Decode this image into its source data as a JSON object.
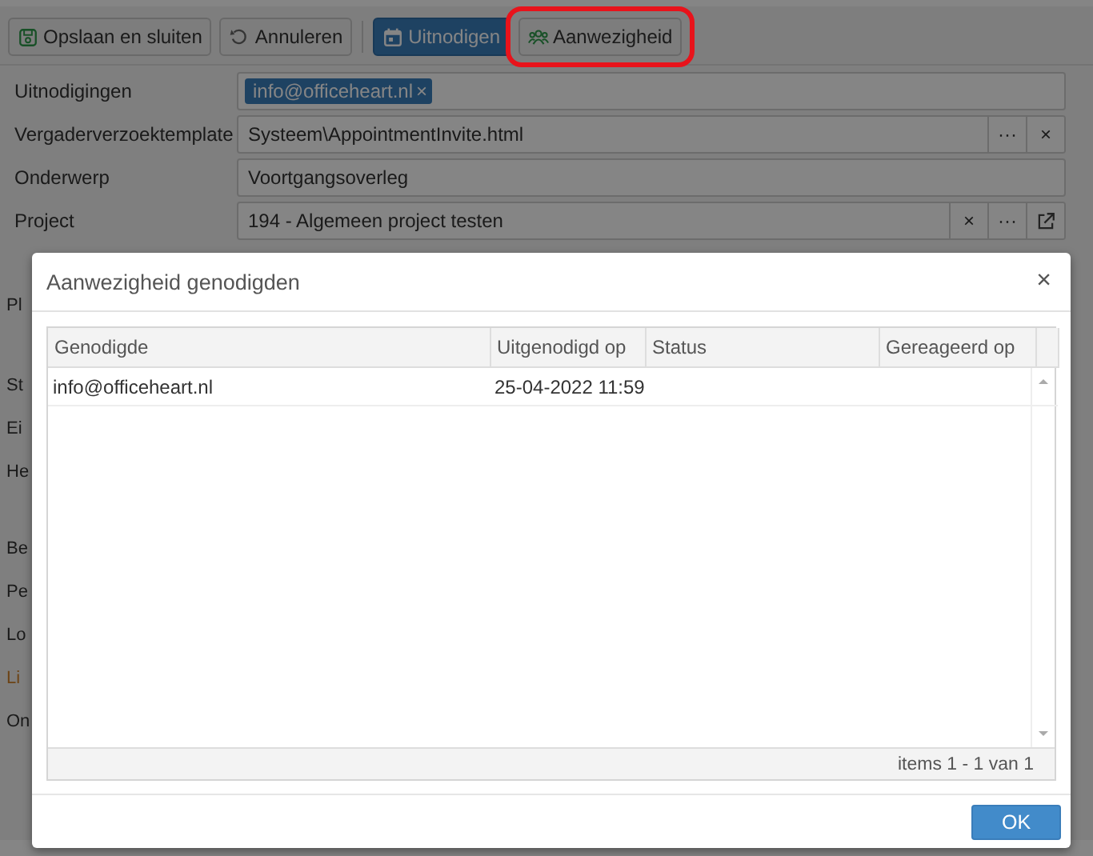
{
  "toolbar": [
    {
      "label": "Opslaan en sluiten",
      "kind": "save",
      "primary": false,
      "highlighted": false
    },
    {
      "label": "Annuleren",
      "kind": "undo",
      "primary": false,
      "highlighted": false
    },
    {
      "label": "Uitnodigen",
      "kind": "calendar",
      "primary": true,
      "highlighted": false
    },
    {
      "label": "Aanwezigheid",
      "kind": "people",
      "primary": false,
      "highlighted": true
    }
  ],
  "form": {
    "fields": [
      {
        "label": "Uitnodigingen",
        "kind": "tags",
        "tags": [
          {
            "text": "info@officeheart.nl",
            "remove": "×"
          }
        ]
      },
      {
        "label": "Vergaderverzoektemplate",
        "kind": "lookup",
        "value": "Systeem\\AppointmentInvite.html",
        "actions": [
          {
            "kind": "text",
            "text": "···"
          },
          {
            "kind": "text",
            "text": "×"
          }
        ]
      },
      {
        "label": "Onderwerp",
        "kind": "text",
        "value": "Voortgangsoverleg"
      },
      {
        "label": "Project",
        "kind": "lookup",
        "value": "194 - Algemeen project testen",
        "actions": [
          {
            "kind": "text",
            "text": "×"
          },
          {
            "kind": "text",
            "text": "···"
          },
          {
            "kind": "open"
          }
        ]
      }
    ],
    "cut_labels": [
      {
        "text": "Pl",
        "link": false
      },
      {
        "text": "St",
        "link": false
      },
      {
        "text": "Ei",
        "link": false
      },
      {
        "text": "He",
        "link": false
      },
      {
        "text": "Be",
        "link": false
      },
      {
        "text": "Pe",
        "link": false
      },
      {
        "text": "Lo",
        "link": false
      },
      {
        "text": "Li",
        "link": true
      },
      {
        "text": "On",
        "link": false
      }
    ]
  },
  "dialog": {
    "title": "Aanwezigheid genodigden",
    "close": "×",
    "table": {
      "columns": [
        "Genodigde",
        "Uitgenodigd op",
        "Status",
        "Gereageerd op"
      ],
      "rows": [
        {
          "cells": [
            "info@officeheart.nl",
            "25-04-2022 11:59"
          ]
        }
      ],
      "pager": "items 1 - 1 van 1"
    },
    "buttons": [
      "OK"
    ]
  }
}
